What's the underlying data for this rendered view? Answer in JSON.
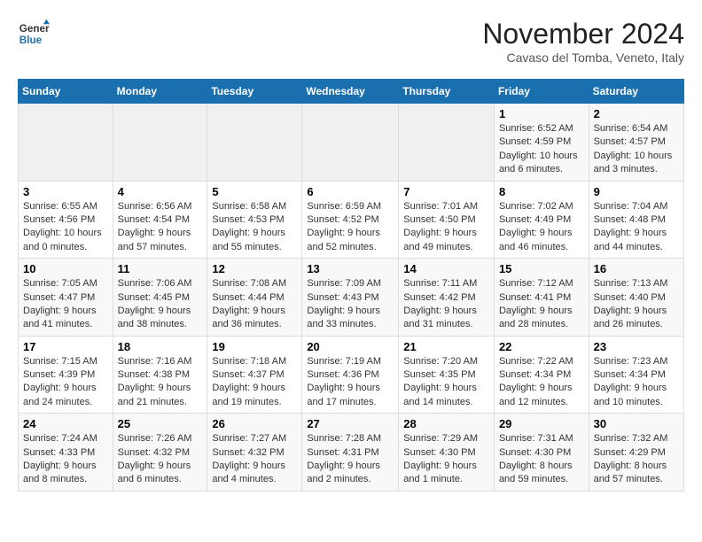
{
  "logo": {
    "general": "General",
    "blue": "Blue"
  },
  "header": {
    "month_title": "November 2024",
    "subtitle": "Cavaso del Tomba, Veneto, Italy"
  },
  "days_of_week": [
    "Sunday",
    "Monday",
    "Tuesday",
    "Wednesday",
    "Thursday",
    "Friday",
    "Saturday"
  ],
  "weeks": [
    [
      {
        "num": "",
        "info": ""
      },
      {
        "num": "",
        "info": ""
      },
      {
        "num": "",
        "info": ""
      },
      {
        "num": "",
        "info": ""
      },
      {
        "num": "",
        "info": ""
      },
      {
        "num": "1",
        "info": "Sunrise: 6:52 AM\nSunset: 4:59 PM\nDaylight: 10 hours and 6 minutes."
      },
      {
        "num": "2",
        "info": "Sunrise: 6:54 AM\nSunset: 4:57 PM\nDaylight: 10 hours and 3 minutes."
      }
    ],
    [
      {
        "num": "3",
        "info": "Sunrise: 6:55 AM\nSunset: 4:56 PM\nDaylight: 10 hours and 0 minutes."
      },
      {
        "num": "4",
        "info": "Sunrise: 6:56 AM\nSunset: 4:54 PM\nDaylight: 9 hours and 57 minutes."
      },
      {
        "num": "5",
        "info": "Sunrise: 6:58 AM\nSunset: 4:53 PM\nDaylight: 9 hours and 55 minutes."
      },
      {
        "num": "6",
        "info": "Sunrise: 6:59 AM\nSunset: 4:52 PM\nDaylight: 9 hours and 52 minutes."
      },
      {
        "num": "7",
        "info": "Sunrise: 7:01 AM\nSunset: 4:50 PM\nDaylight: 9 hours and 49 minutes."
      },
      {
        "num": "8",
        "info": "Sunrise: 7:02 AM\nSunset: 4:49 PM\nDaylight: 9 hours and 46 minutes."
      },
      {
        "num": "9",
        "info": "Sunrise: 7:04 AM\nSunset: 4:48 PM\nDaylight: 9 hours and 44 minutes."
      }
    ],
    [
      {
        "num": "10",
        "info": "Sunrise: 7:05 AM\nSunset: 4:47 PM\nDaylight: 9 hours and 41 minutes."
      },
      {
        "num": "11",
        "info": "Sunrise: 7:06 AM\nSunset: 4:45 PM\nDaylight: 9 hours and 38 minutes."
      },
      {
        "num": "12",
        "info": "Sunrise: 7:08 AM\nSunset: 4:44 PM\nDaylight: 9 hours and 36 minutes."
      },
      {
        "num": "13",
        "info": "Sunrise: 7:09 AM\nSunset: 4:43 PM\nDaylight: 9 hours and 33 minutes."
      },
      {
        "num": "14",
        "info": "Sunrise: 7:11 AM\nSunset: 4:42 PM\nDaylight: 9 hours and 31 minutes."
      },
      {
        "num": "15",
        "info": "Sunrise: 7:12 AM\nSunset: 4:41 PM\nDaylight: 9 hours and 28 minutes."
      },
      {
        "num": "16",
        "info": "Sunrise: 7:13 AM\nSunset: 4:40 PM\nDaylight: 9 hours and 26 minutes."
      }
    ],
    [
      {
        "num": "17",
        "info": "Sunrise: 7:15 AM\nSunset: 4:39 PM\nDaylight: 9 hours and 24 minutes."
      },
      {
        "num": "18",
        "info": "Sunrise: 7:16 AM\nSunset: 4:38 PM\nDaylight: 9 hours and 21 minutes."
      },
      {
        "num": "19",
        "info": "Sunrise: 7:18 AM\nSunset: 4:37 PM\nDaylight: 9 hours and 19 minutes."
      },
      {
        "num": "20",
        "info": "Sunrise: 7:19 AM\nSunset: 4:36 PM\nDaylight: 9 hours and 17 minutes."
      },
      {
        "num": "21",
        "info": "Sunrise: 7:20 AM\nSunset: 4:35 PM\nDaylight: 9 hours and 14 minutes."
      },
      {
        "num": "22",
        "info": "Sunrise: 7:22 AM\nSunset: 4:34 PM\nDaylight: 9 hours and 12 minutes."
      },
      {
        "num": "23",
        "info": "Sunrise: 7:23 AM\nSunset: 4:34 PM\nDaylight: 9 hours and 10 minutes."
      }
    ],
    [
      {
        "num": "24",
        "info": "Sunrise: 7:24 AM\nSunset: 4:33 PM\nDaylight: 9 hours and 8 minutes."
      },
      {
        "num": "25",
        "info": "Sunrise: 7:26 AM\nSunset: 4:32 PM\nDaylight: 9 hours and 6 minutes."
      },
      {
        "num": "26",
        "info": "Sunrise: 7:27 AM\nSunset: 4:32 PM\nDaylight: 9 hours and 4 minutes."
      },
      {
        "num": "27",
        "info": "Sunrise: 7:28 AM\nSunset: 4:31 PM\nDaylight: 9 hours and 2 minutes."
      },
      {
        "num": "28",
        "info": "Sunrise: 7:29 AM\nSunset: 4:30 PM\nDaylight: 9 hours and 1 minute."
      },
      {
        "num": "29",
        "info": "Sunrise: 7:31 AM\nSunset: 4:30 PM\nDaylight: 8 hours and 59 minutes."
      },
      {
        "num": "30",
        "info": "Sunrise: 7:32 AM\nSunset: 4:29 PM\nDaylight: 8 hours and 57 minutes."
      }
    ]
  ]
}
